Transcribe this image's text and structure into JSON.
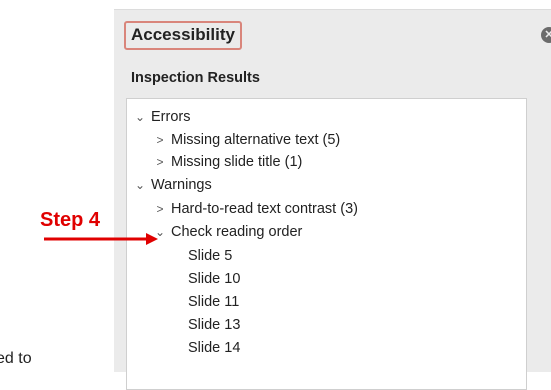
{
  "pane": {
    "title": "Accessibility",
    "close_icon": "close-icon",
    "subheading": "Inspection Results"
  },
  "tree": {
    "errors": {
      "label": "Errors",
      "items": [
        "Missing alternative text (5)",
        "Missing slide title (1)"
      ]
    },
    "warnings": {
      "label": "Warnings",
      "items": [
        "Hard-to-read text contrast (3)",
        "Check reading order"
      ]
    },
    "reading_order_slides": [
      "Slide 5",
      "Slide 10",
      "Slide 11",
      "Slide 13",
      "Slide 14"
    ]
  },
  "annotation": {
    "step_label": "Step 4",
    "arrow_color": "#e00000"
  },
  "background_text": "ed to"
}
